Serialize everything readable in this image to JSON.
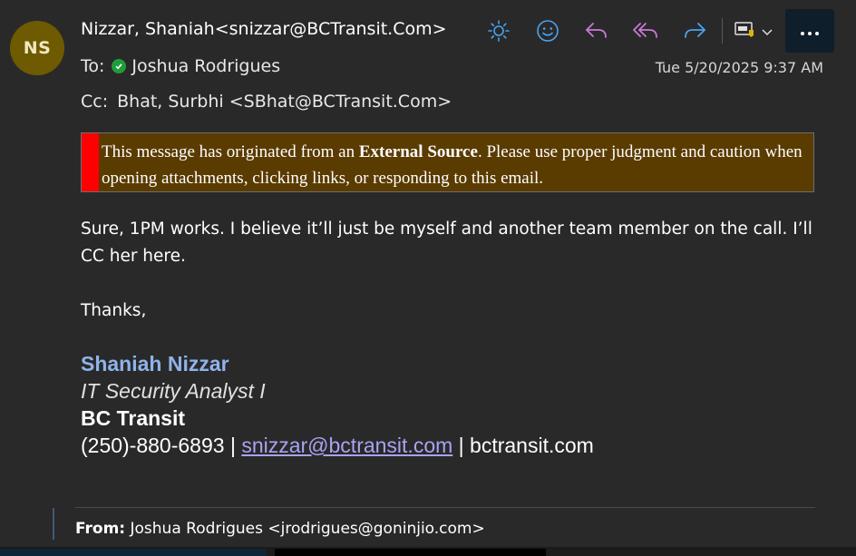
{
  "sender": {
    "initials": "NS",
    "from": "Nizzar, Shaniah<snizzar@BCTransit.Com>",
    "to_label": "To:",
    "to_name": "Joshua Rodrigues",
    "cc_label": "Cc:",
    "cc_value": "Bhat, Surbhi <SBhat@BCTransit.Com>",
    "date": "Tue 5/20/2025 9:37 AM"
  },
  "toolbar": {
    "icons": [
      "sun-icon",
      "smiley-icon",
      "reply-icon",
      "reply-all-icon",
      "forward-icon",
      "apps-icon",
      "more-icon"
    ],
    "accent_colors": {
      "sun": "#4aa3f0",
      "reply": "#c77ad6",
      "forward": "#4aa3f0"
    }
  },
  "banner": {
    "part1": "This message has originated from an ",
    "bold": "External Source",
    "part2": ". Please use proper judgment and caution when opening attachments, clicking links, or responding to this email."
  },
  "body": {
    "line1": "Sure, 1PM works. I believe it’ll just be myself and another team member on the call. I’ll CC her here.",
    "thanks": "Thanks,"
  },
  "signature": {
    "name": "Shaniah Nizzar",
    "title": "IT Security Analyst I",
    "org": "BC Transit",
    "phone": "(250)-880-6893 | ",
    "email": "snizzar@bctransit.com",
    "site": " | bctransit.com"
  },
  "quoted": {
    "from_label": "From:",
    "from_value": " Joshua Rodrigues <jrodrigues@goninjio.com>"
  }
}
